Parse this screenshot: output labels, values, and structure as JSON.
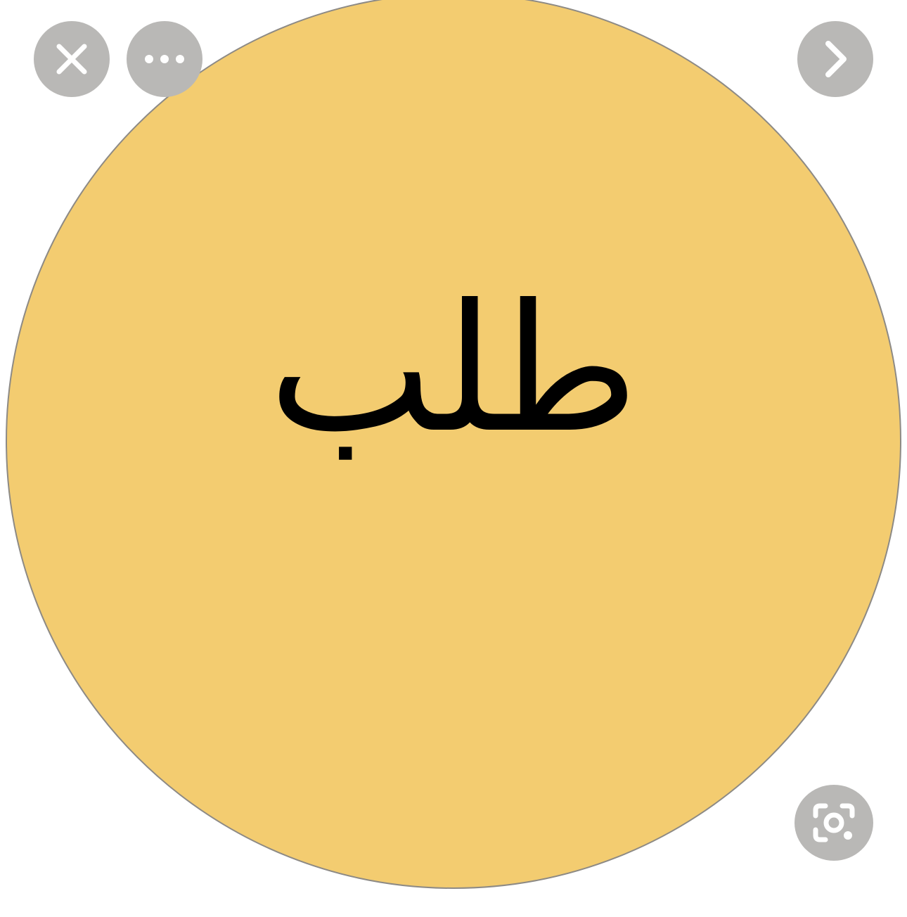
{
  "image": {
    "text": "طلب",
    "circle_fill": "#f3cc70",
    "circle_stroke": "#8d8a85",
    "text_color": "#000000"
  },
  "controls": {
    "button_fill": "#b9b8b6",
    "icon_color": "#ffffff",
    "close_icon": "close-icon",
    "more_icon": "more-horizontal-icon",
    "next_icon": "chevron-right-icon",
    "lens_icon": "visual-search-icon"
  }
}
